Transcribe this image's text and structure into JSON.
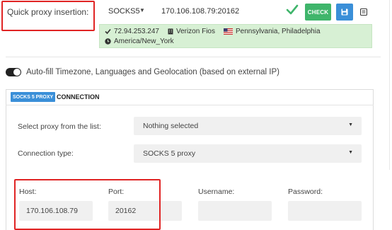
{
  "quick_proxy": {
    "label": "Quick proxy insertion:",
    "protocol": "SOCKS5",
    "value": "170.106.108.79:20162",
    "check_label": "CHECK"
  },
  "geo": {
    "ip": "72.94.253.247",
    "isp": "Verizon Fios",
    "location": "Pennsylvania, Philadelphia",
    "timezone": "America/New_York"
  },
  "autofill": {
    "label": "Auto-fill Timezone, Languages and Geolocation (based on external IP)",
    "enabled": true
  },
  "connection": {
    "badge": "SOCKS 5 PROXY",
    "title": "CONNECTION",
    "proxy_list_label": "Select proxy from the list:",
    "proxy_list_value": "Nothing selected",
    "type_label": "Connection type:",
    "type_value": "SOCKS 5 proxy",
    "host_label": "Host:",
    "host_value": "170.106.108.79",
    "port_label": "Port:",
    "port_value": "20162",
    "username_label": "Username:",
    "username_value": "",
    "password_label": "Password:",
    "password_value": ""
  },
  "colors": {
    "check_button": "#3fb56b",
    "save_button": "#3a8fd8",
    "geo_panel": "#d7f0d4",
    "highlight": "#e02424"
  }
}
